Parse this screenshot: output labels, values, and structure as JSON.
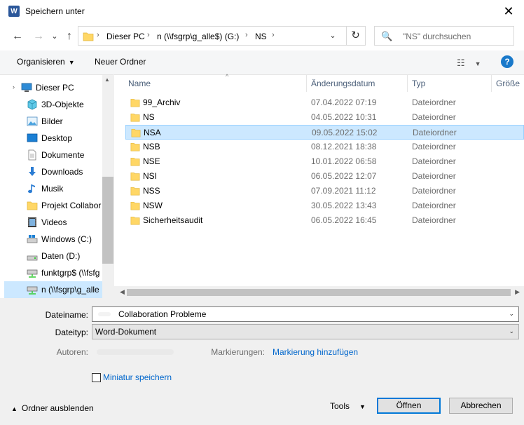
{
  "window": {
    "title": "Speichern unter",
    "app_icon_letter": "W",
    "close_glyph": "✕"
  },
  "nav_buttons": {
    "back": "←",
    "forward": "→",
    "up": "↑",
    "dropdown": "⌄"
  },
  "address": {
    "crumbs": [
      "Dieser PC",
      "n (\\\\fsgrp\\g_alle$) (G:)",
      "NS"
    ],
    "separator": "›",
    "dropdown_glyph": "⌄",
    "refresh_glyph": "↻"
  },
  "search": {
    "placeholder": "\"NS\" durchsuchen",
    "icon": "🔍"
  },
  "toolbar": {
    "organize": "Organisieren",
    "new_folder": "Neuer Ordner",
    "view_icon": "☷",
    "dropdown_glyph": "▼",
    "help": "?"
  },
  "nav_pane": {
    "items": [
      {
        "label": "Dieser PC",
        "icon": "pc-icon",
        "top": true
      },
      {
        "label": "3D-Objekte",
        "icon": "cube-icon"
      },
      {
        "label": "Bilder",
        "icon": "pictures-icon"
      },
      {
        "label": "Desktop",
        "icon": "desktop-icon"
      },
      {
        "label": "Dokumente",
        "icon": "documents-icon"
      },
      {
        "label": "Downloads",
        "icon": "downloads-icon"
      },
      {
        "label": "Musik",
        "icon": "music-icon"
      },
      {
        "label": "Projekt Collabor",
        "icon": "folder-icon"
      },
      {
        "label": "Videos",
        "icon": "videos-icon"
      },
      {
        "label": "Windows (C:)",
        "icon": "drive-icon"
      },
      {
        "label": "Daten (D:)",
        "icon": "drive-icon"
      },
      {
        "label": "funktgrp$ (\\\\fsfg",
        "icon": "network-drive-icon"
      },
      {
        "label": "n (\\\\fsgrp\\g_alle",
        "icon": "network-drive-icon",
        "selected": true
      }
    ],
    "expander_glyph": "›"
  },
  "columns": {
    "name": "Name",
    "date": "Änderungsdatum",
    "type": "Typ",
    "size": "Größe",
    "sort_caret": "^"
  },
  "files": [
    {
      "name": "99_Archiv",
      "date": "07.04.2022 07:19",
      "type": "Dateiordner"
    },
    {
      "name": "NS",
      "date": "04.05.2022 10:31",
      "type": "Dateiordner"
    },
    {
      "name": "NSA",
      "date": "09.05.2022 15:02",
      "type": "Dateiordner",
      "selected": true
    },
    {
      "name": "NSB",
      "date": "08.12.2021 18:38",
      "type": "Dateiordner"
    },
    {
      "name": "NSE",
      "date": "10.01.2022 06:58",
      "type": "Dateiordner"
    },
    {
      "name": "NSI",
      "date": "06.05.2022 12:07",
      "type": "Dateiordner"
    },
    {
      "name": "NSS",
      "date": "07.09.2021 11:12",
      "type": "Dateiordner"
    },
    {
      "name": "NSW",
      "date": "30.05.2022 13:43",
      "type": "Dateiordner"
    },
    {
      "name": "Sicherheitsaudit",
      "date": "06.05.2022 16:45",
      "type": "Dateiordner"
    }
  ],
  "form": {
    "filename_label": "Dateiname:",
    "filename_value": "Collaboration Probleme",
    "filetype_label": "Dateityp:",
    "filetype_value": "Word-Dokument",
    "authors_label": "Autoren:",
    "tags_label": "Markierungen:",
    "tags_link": "Markierung hinzufügen",
    "thumbnail_label": "Miniatur speichern",
    "dropdown_glyph": "⌄"
  },
  "footer": {
    "hide_folders": "Ordner ausblenden",
    "hide_caret": "▲",
    "tools": "Tools",
    "tools_caret": "▼",
    "open_button": "Öffnen",
    "cancel_button": "Abbrechen"
  },
  "colors": {
    "selection": "#cce8ff",
    "link": "#0066cc",
    "folder": "#ffd766",
    "accent": "#0078d7"
  }
}
